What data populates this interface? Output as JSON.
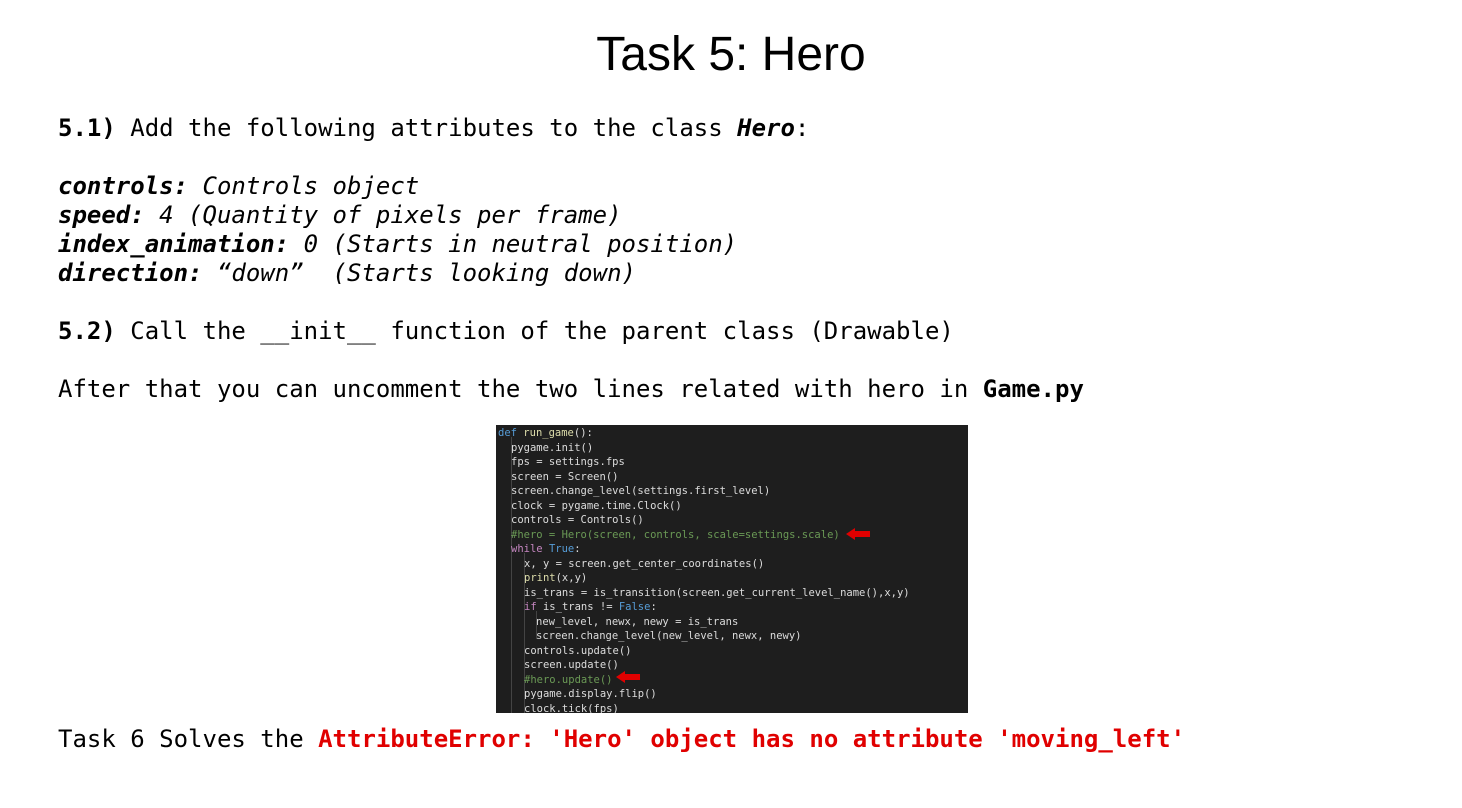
{
  "title": "Task 5: Hero",
  "s1": {
    "num": "5.1)",
    "text": " Add the following attributes to the class ",
    "cls": "Hero",
    "end": ":"
  },
  "attrs": [
    {
      "name": "controls:",
      "desc": " Controls object"
    },
    {
      "name": "speed:",
      "desc": " 4 (Quantity of pixels per frame)"
    },
    {
      "name": "index_animation:",
      "desc": " 0 (Starts in neutral position)"
    },
    {
      "name": "direction:",
      "desc": " “down”  (Starts looking down)"
    }
  ],
  "s2": {
    "num": "5.2)",
    "text": " Call the __init__ function of the parent class (Drawable)"
  },
  "after": {
    "text": "After that you can uncomment the two lines related with hero in ",
    "file": "Game.py"
  },
  "code": {
    "def": "def",
    "fname": "run_game",
    "sig": "():",
    "lines": [
      "pygame.init()",
      "fps = settings.fps",
      "screen = Screen()",
      "screen.change_level(settings.first_level)",
      "clock = pygame.time.Clock()",
      "controls = Controls()"
    ],
    "hero_comment": "#hero = Hero(screen, controls, scale=settings.scale)",
    "while_kw": "while",
    "while_true": "True",
    "colon": ":",
    "l_xy": "x, y = screen.get_center_coordinates()",
    "print_kw": "print",
    "print_args": "(x,y)",
    "l_trans": "is_trans = is_transition(screen.get_current_level_name(),x,y)",
    "if_kw": "if",
    "if_mid": " is_trans != ",
    "if_false": "False",
    "l_new": "new_level, newx, newy = is_trans",
    "l_change": "screen.change_level(new_level, newx, newy)",
    "l_ctrl": "controls.update()",
    "l_scr": "screen.update()",
    "update_comment": "#hero.update()",
    "l_flip": "pygame.display.flip()",
    "l_tick": "clock.tick(fps)"
  },
  "task6": {
    "text": "Task 6 Solves the ",
    "error": "AttributeError: 'Hero' object has no attribute 'moving_left'"
  },
  "colors": {
    "error": "#e00000",
    "arrow": "#e00000",
    "code_bg": "#1e1e1e",
    "comment": "#6a9955"
  }
}
